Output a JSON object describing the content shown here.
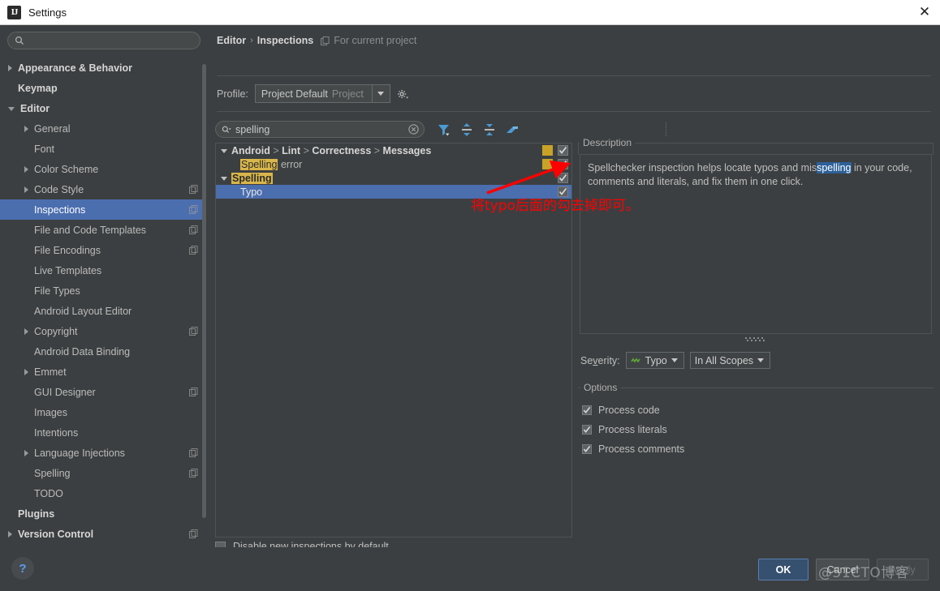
{
  "window": {
    "title": "Settings",
    "logo_text": "IJ",
    "close_icon": "close-icon"
  },
  "sidebar": {
    "search_placeholder": "",
    "search_value": "",
    "items": [
      {
        "label": "Appearance & Behavior",
        "arrow": "right",
        "bold": true,
        "indent": 0,
        "copy": false
      },
      {
        "label": "Keymap",
        "arrow": "none",
        "bold": true,
        "indent": 0,
        "copy": false
      },
      {
        "label": "Editor",
        "arrow": "down",
        "bold": true,
        "indent": 0,
        "copy": false
      },
      {
        "label": "General",
        "arrow": "right",
        "bold": false,
        "indent": 1,
        "copy": false
      },
      {
        "label": "Font",
        "arrow": "none",
        "bold": false,
        "indent": 1,
        "copy": false
      },
      {
        "label": "Color Scheme",
        "arrow": "right",
        "bold": false,
        "indent": 1,
        "copy": false
      },
      {
        "label": "Code Style",
        "arrow": "right",
        "bold": false,
        "indent": 1,
        "copy": true
      },
      {
        "label": "Inspections",
        "arrow": "none",
        "bold": false,
        "indent": 1,
        "copy": true,
        "selected": true
      },
      {
        "label": "File and Code Templates",
        "arrow": "none",
        "bold": false,
        "indent": 1,
        "copy": true
      },
      {
        "label": "File Encodings",
        "arrow": "none",
        "bold": false,
        "indent": 1,
        "copy": true
      },
      {
        "label": "Live Templates",
        "arrow": "none",
        "bold": false,
        "indent": 1,
        "copy": false
      },
      {
        "label": "File Types",
        "arrow": "none",
        "bold": false,
        "indent": 1,
        "copy": false
      },
      {
        "label": "Android Layout Editor",
        "arrow": "none",
        "bold": false,
        "indent": 1,
        "copy": false
      },
      {
        "label": "Copyright",
        "arrow": "right",
        "bold": false,
        "indent": 1,
        "copy": true
      },
      {
        "label": "Android Data Binding",
        "arrow": "none",
        "bold": false,
        "indent": 1,
        "copy": false
      },
      {
        "label": "Emmet",
        "arrow": "right",
        "bold": false,
        "indent": 1,
        "copy": false
      },
      {
        "label": "GUI Designer",
        "arrow": "none",
        "bold": false,
        "indent": 1,
        "copy": true
      },
      {
        "label": "Images",
        "arrow": "none",
        "bold": false,
        "indent": 1,
        "copy": false
      },
      {
        "label": "Intentions",
        "arrow": "none",
        "bold": false,
        "indent": 1,
        "copy": false
      },
      {
        "label": "Language Injections",
        "arrow": "right",
        "bold": false,
        "indent": 1,
        "copy": true
      },
      {
        "label": "Spelling",
        "arrow": "none",
        "bold": false,
        "indent": 1,
        "copy": true
      },
      {
        "label": "TODO",
        "arrow": "none",
        "bold": false,
        "indent": 1,
        "copy": false
      },
      {
        "label": "Plugins",
        "arrow": "none",
        "bold": true,
        "indent": 0,
        "copy": false
      },
      {
        "label": "Version Control",
        "arrow": "right",
        "bold": true,
        "indent": 0,
        "copy": true
      }
    ]
  },
  "breadcrumb": {
    "root": "Editor",
    "separator": "›",
    "current": "Inspections",
    "scope_icon": "copy-icon",
    "scope": "For current project"
  },
  "profile": {
    "label": "Profile:",
    "value": "Project Default",
    "suffix": "Project",
    "dropdown_icon": "chevron-down-icon",
    "gear_icon": "gear-icon"
  },
  "toolbar": {
    "search_value": "spelling",
    "search_icon": "search-icon",
    "clear_icon": "clear-icon",
    "buttons": [
      {
        "icon": "filter-icon",
        "name": "filter-inspections-button"
      },
      {
        "icon": "expand-all-icon",
        "name": "expand-all-button"
      },
      {
        "icon": "collapse-all-icon",
        "name": "collapse-all-button"
      },
      {
        "icon": "reset-icon",
        "name": "reset-to-defaults-button"
      }
    ]
  },
  "inspection_tree": [
    {
      "type": "group",
      "arrow": "down",
      "indent": 0,
      "parts": [
        {
          "t": "Android",
          "style": "bold"
        },
        {
          "t": " > ",
          "style": "gt"
        },
        {
          "t": "Lint",
          "style": "bold"
        },
        {
          "t": " > ",
          "style": "gt"
        },
        {
          "t": "Correctness",
          "style": "bold"
        },
        {
          "t": " > ",
          "style": "gt"
        },
        {
          "t": "Messages",
          "style": "bold"
        }
      ],
      "swatch": true,
      "checked": true,
      "selected": false
    },
    {
      "type": "item",
      "arrow": "none",
      "indent": 2,
      "parts": [
        {
          "t": "Spelling",
          "style": "hl"
        },
        {
          "t": " error",
          "style": "light"
        }
      ],
      "swatch": true,
      "checked": true,
      "selected": false
    },
    {
      "type": "group",
      "arrow": "down",
      "indent": 0,
      "parts": [
        {
          "t": "Spelling",
          "style": "hlbold"
        }
      ],
      "swatch": false,
      "checked": true,
      "selected": false
    },
    {
      "type": "item",
      "arrow": "none",
      "indent": 2,
      "parts": [
        {
          "t": "Typo",
          "style": "light"
        }
      ],
      "swatch": false,
      "checked": true,
      "selected": true
    }
  ],
  "description": {
    "legend": "Description",
    "text_before": "Spellchecker inspection helps locate typos and mis",
    "highlight": "spelling",
    "text_after": " in your code, comments and literals, and fix them in one click."
  },
  "severity": {
    "label": "Severity:",
    "value": "Typo",
    "icon": "squiggle-icon",
    "scope": "In All Scopes"
  },
  "options": {
    "legend": "Options",
    "items": [
      {
        "label": "Process code",
        "checked": true
      },
      {
        "label": "Process literals",
        "checked": true
      },
      {
        "label": "Process comments",
        "checked": true
      }
    ]
  },
  "bottom": {
    "disable_new_label": "Disable new inspections by default",
    "disable_new_checked": false,
    "help_icon": "?",
    "ok": "OK",
    "cancel": "Cancel",
    "apply": "Apply"
  },
  "annotation": {
    "text": "将typo后面的勾去掉即可。",
    "color": "#ff0000",
    "arrow_icon": "red-arrow-icon"
  },
  "watermark": "@51CTO博客",
  "colors": {
    "selection_blue": "#4b6eaf",
    "panel_bg": "#3c3f41",
    "severity_yellow": "#c9a227",
    "match_highlight": "#d9b64a",
    "desc_match": "#2d6099",
    "accent_icon": "#4a9ad4"
  }
}
